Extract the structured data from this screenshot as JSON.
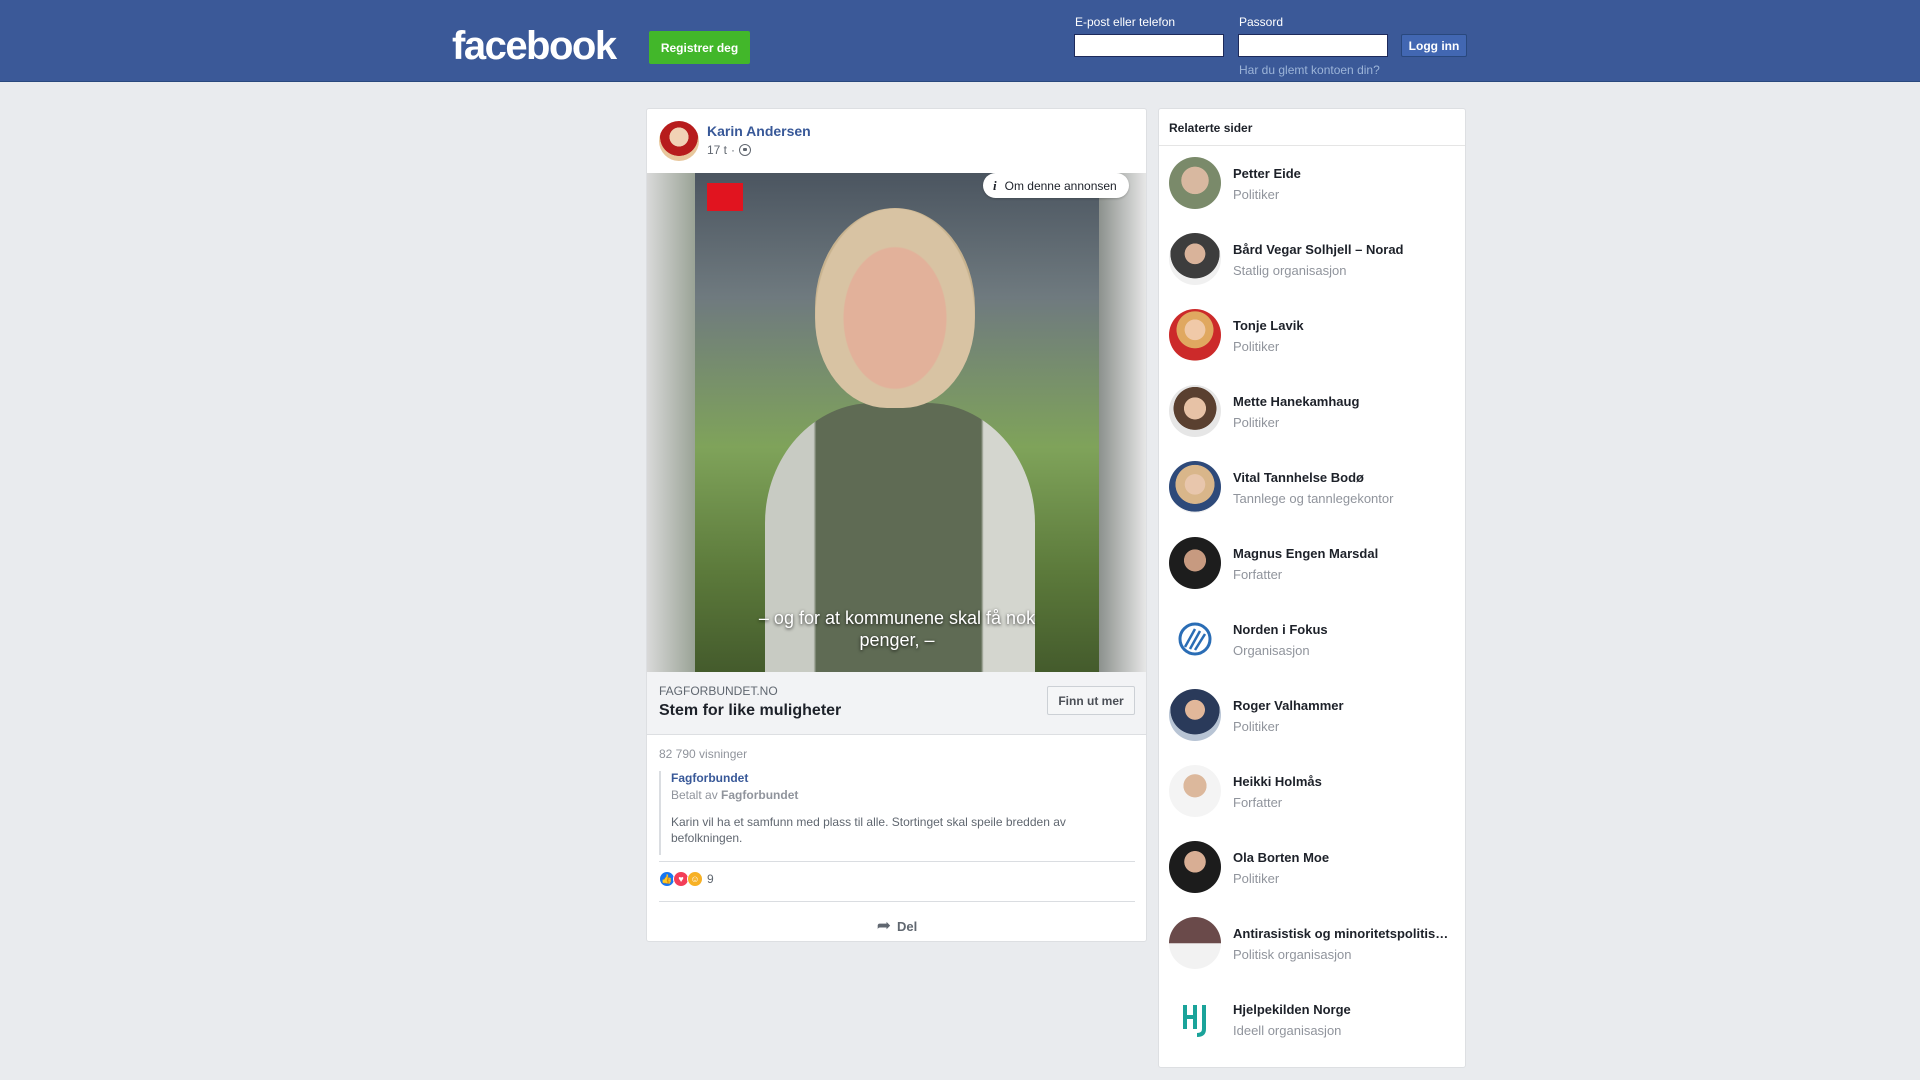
{
  "header": {
    "logo_text": "facebook",
    "register_label": "Registrer deg",
    "email_label": "E-post eller telefon",
    "email_value": "",
    "password_label": "Passord",
    "password_value": "",
    "login_label": "Logg inn",
    "forgot_label": "Har du glemt kontoen din?",
    "brand_color": "#3b5998",
    "register_color": "#42b72a"
  },
  "post": {
    "author": "Karin Andersen",
    "time": "17 t",
    "separator": "·",
    "privacy_icon": "globe-icon",
    "about_ad_label": "Om denne annonsen",
    "video_caption": "– og for at kommunene skal få nok penger, –",
    "link_domain": "FAGFORBUNDET.NO",
    "link_title": "Stem for like muligheter",
    "cta_label": "Finn ut mer",
    "views": "82 790 visninger",
    "sponsor_name": "Fagforbundet",
    "paid_prefix": "Betalt av",
    "paid_by": "Fagforbundet",
    "description": "Karin vil ha et samfunn med plass til alle. Stortinget skal speile bredden av befolkningen.",
    "reaction_icons": [
      "like-icon",
      "love-icon",
      "care-icon"
    ],
    "reaction_count": "9",
    "share_label": "Del"
  },
  "related": {
    "title": "Relaterte sider",
    "items": [
      {
        "name": "Petter Eide",
        "category": "Politiker"
      },
      {
        "name": "Bård Vegar Solhjell – Norad",
        "category": "Statlig organisasjon"
      },
      {
        "name": "Tonje Lavik",
        "category": "Politiker"
      },
      {
        "name": "Mette Hanekamhaug",
        "category": "Politiker"
      },
      {
        "name": "Vital Tannhelse Bodø",
        "category": "Tannlege og tannlegekontor"
      },
      {
        "name": "Magnus Engen Marsdal",
        "category": "Forfatter"
      },
      {
        "name": "Norden i Fokus",
        "category": "Organisasjon"
      },
      {
        "name": "Roger Valhammer",
        "category": "Politiker"
      },
      {
        "name": "Heikki Holmås",
        "category": "Forfatter"
      },
      {
        "name": "Ola Borten Moe",
        "category": "Politiker"
      },
      {
        "name": "Antirasistisk og minoritetspolitis…",
        "category": "Politisk organisasjon"
      },
      {
        "name": "Hjelpekilden Norge",
        "category": "Ideell organisasjon"
      }
    ]
  }
}
